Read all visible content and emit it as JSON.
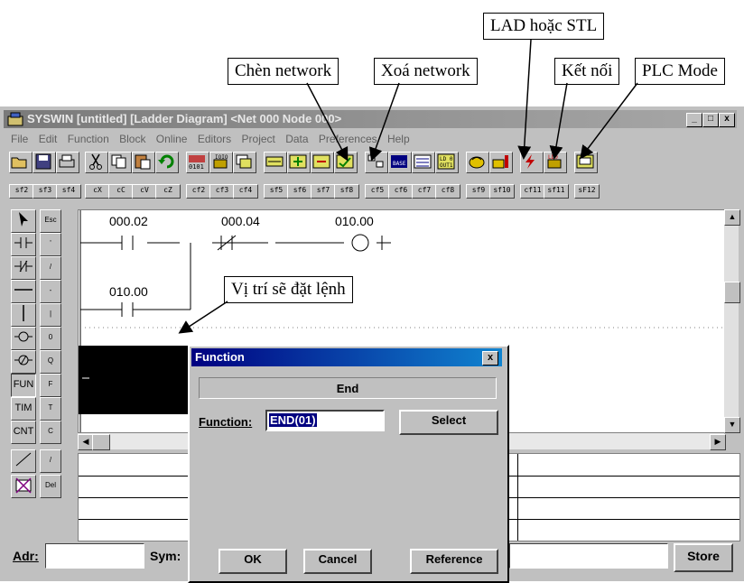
{
  "callouts": {
    "lad_stl": "LAD hoặc STL",
    "insert_network": "Chèn network",
    "delete_network": "Xoá network",
    "connect": "Kết nối",
    "plc_mode": "PLC Mode",
    "instruction_position": "Vị trí sẽ đặt lệnh"
  },
  "window": {
    "title": "SYSWIN [untitled] [Ladder Diagram] <Net 000 Node 000>",
    "minimize": "_",
    "maximize": "□",
    "close": "x"
  },
  "menu": [
    "File",
    "Edit",
    "Function",
    "Block",
    "Online",
    "Editors",
    "Project",
    "Data",
    "Preferences",
    "Help"
  ],
  "function_keys": [
    "sf2",
    "sf3",
    "sf4",
    "cX",
    "cC",
    "cV",
    "cZ",
    "cf2",
    "cf3",
    "cf4",
    "sf5",
    "sf6",
    "sf7",
    "sf8",
    "cf5",
    "cf6",
    "cf7",
    "cf8",
    "sf9",
    "sf10",
    "cf11",
    "sf11",
    "sF12"
  ],
  "left_tools": {
    "esc": "Esc",
    "fun": "FUN",
    "tim": "TIM",
    "cnt": "CNT",
    "keys": [
      "'",
      "/",
      "-",
      "|",
      "0",
      "Q",
      "F",
      "T",
      "C",
      "/",
      "Del"
    ]
  },
  "ladder": {
    "contacts": [
      "000.02",
      "000.04",
      "010.00",
      "010.00"
    ]
  },
  "dialog": {
    "title": "Function",
    "header": "End",
    "function_label": "Function:",
    "function_value": "END(01)",
    "select": "Select",
    "ok": "OK",
    "cancel": "Cancel",
    "reference": "Reference",
    "close": "x"
  },
  "status": {
    "adr_label": "Adr:",
    "sym_label": "Sym:",
    "store": "Store"
  }
}
